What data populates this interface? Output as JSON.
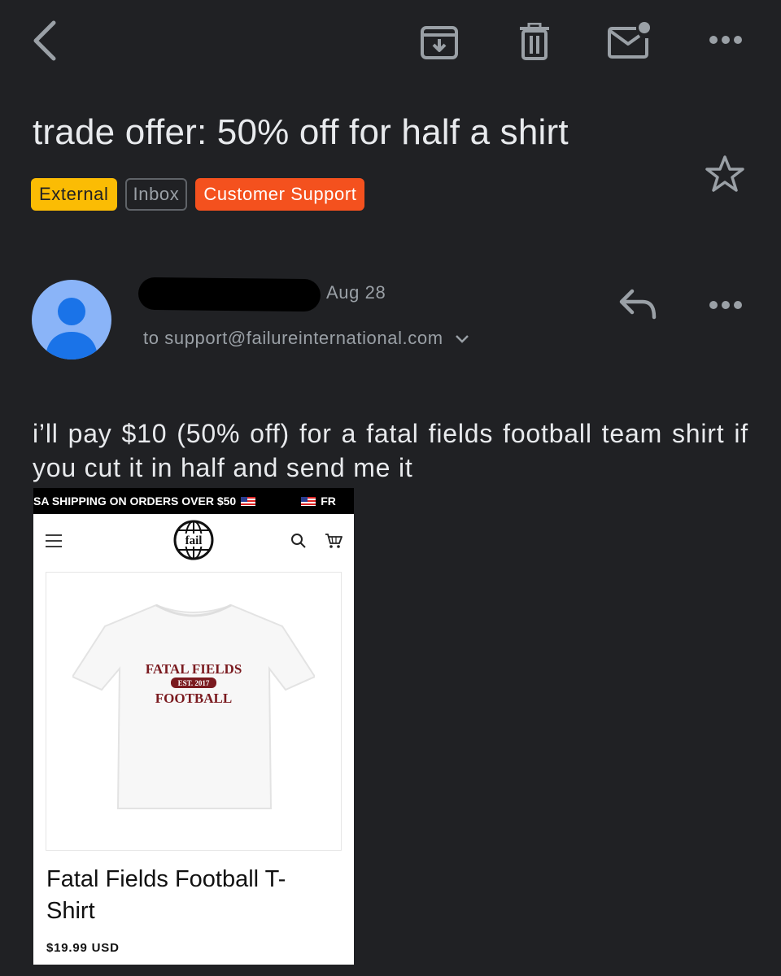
{
  "toolbar": {
    "back": "back-icon",
    "archive": "archive-icon",
    "delete": "trash-icon",
    "mark_unread": "mark-unread-icon",
    "more": "more-icon"
  },
  "email": {
    "subject": "trade offer: 50% off for half a shirt",
    "labels": [
      "External",
      "Inbox",
      "Customer Support"
    ],
    "date": "Aug 28",
    "to": "to support@failureinternational.com",
    "body": "i’ll pay $10 (50% off) for a fatal fields football team shirt if you cut it in half and send me it"
  },
  "attachment": {
    "banner": "SA SHIPPING ON ORDERS OVER $50",
    "banner_tail": "FR",
    "logo_text": "fail",
    "shirt_print": {
      "line1": "FATAL FIELDS",
      "line2": "EST. 2017",
      "line3": "FOOTBALL"
    },
    "product_title": "Fatal Fields Football T-Shirt",
    "price": "$19.99 USD"
  },
  "colors": {
    "background": "#202124",
    "label_external": "#fbbc04",
    "label_support": "#f4511e",
    "avatar": "#8ab4f8",
    "shirt_print": "#7a1a1f"
  }
}
